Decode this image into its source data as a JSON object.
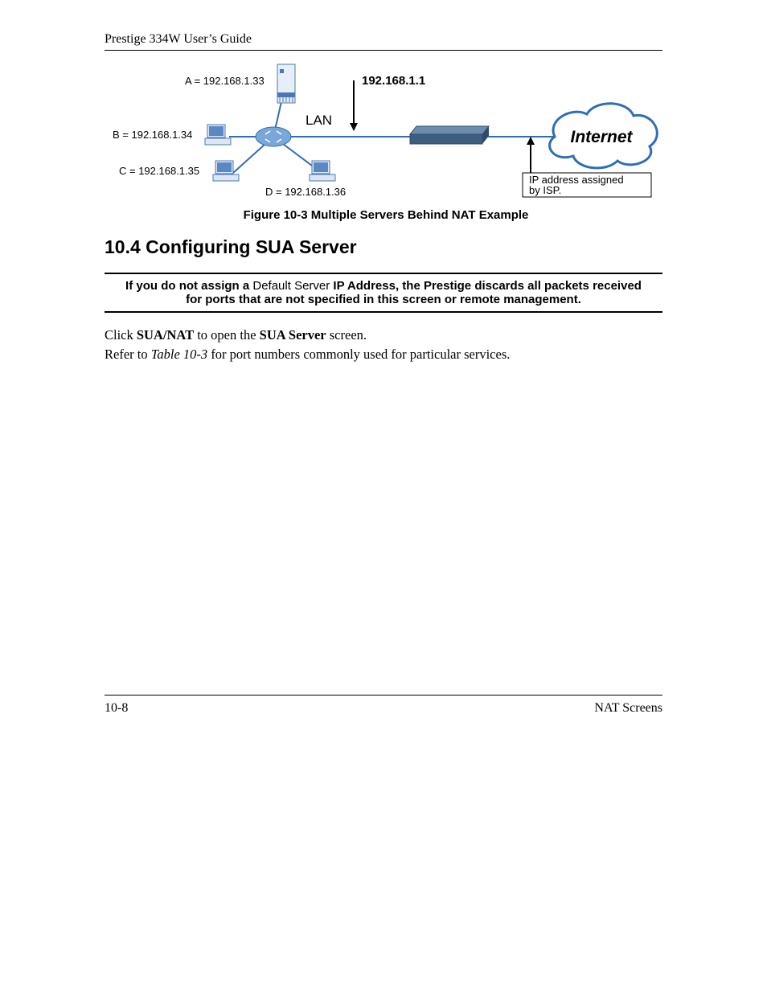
{
  "header": "Prestige 334W User’s Guide",
  "diagram": {
    "a_label": "A = 192.168.1.33",
    "b_label": "B = 192.168.1.34",
    "c_label": "C  = 192.168.1.35",
    "d_label": "D = 192.168.1.36",
    "router_ip": "192.168.1.1",
    "lan_label": "LAN",
    "internet_label": "Internet",
    "isp_note": "IP address assigned by ISP."
  },
  "figure_caption": "Figure 10-3 Multiple Servers Behind NAT Example",
  "section_heading": "10.4  Configuring SUA Server",
  "note": {
    "pre": "If you do not assign a ",
    "mid": "Default Server",
    "post": " IP Address, the Prestige discards all packets received for ports that are not specified in this screen or remote management."
  },
  "body1": {
    "pre": "Click ",
    "b1": "SUA/NAT",
    "mid": " to open the ",
    "b2": "SUA Server",
    "post": " screen."
  },
  "body2": {
    "pre": "Refer to ",
    "i": "Table 10-3",
    "post": " for port numbers commonly used for particular services."
  },
  "footer": {
    "left": "10-8",
    "right": "NAT Screens"
  }
}
